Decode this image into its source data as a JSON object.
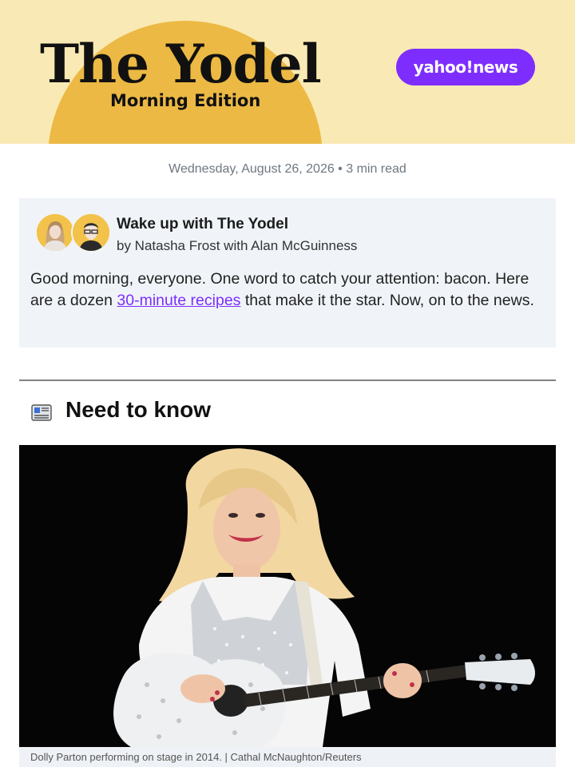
{
  "header": {
    "title": "The Yodel",
    "edition": "Morning Edition",
    "brand": "yahoo!news",
    "colors": {
      "background": "#f9e9b4",
      "sun": "#ecb944",
      "brand_pill": "#7d2eff"
    }
  },
  "meta": {
    "dateline": "Wednesday, August 26, 2026 • 3 min read"
  },
  "intro": {
    "avatars": [
      "author-natasha-avatar",
      "author-alan-avatar"
    ],
    "title": "Wake up with The Yodel",
    "byline": "by Natasha Frost with Alan McGuinness",
    "body_before": "Good morning, everyone. One word to catch your attention: bacon. Here are a dozen ",
    "link_text": "30-minute recipes",
    "body_after": " that make it the star. Now, on to the news."
  },
  "section": {
    "icon": "newspaper-icon",
    "title": "Need to know"
  },
  "photo": {
    "caption": "Dolly Parton performing on stage in 2014. | Cathal McNaughton/Reuters"
  }
}
